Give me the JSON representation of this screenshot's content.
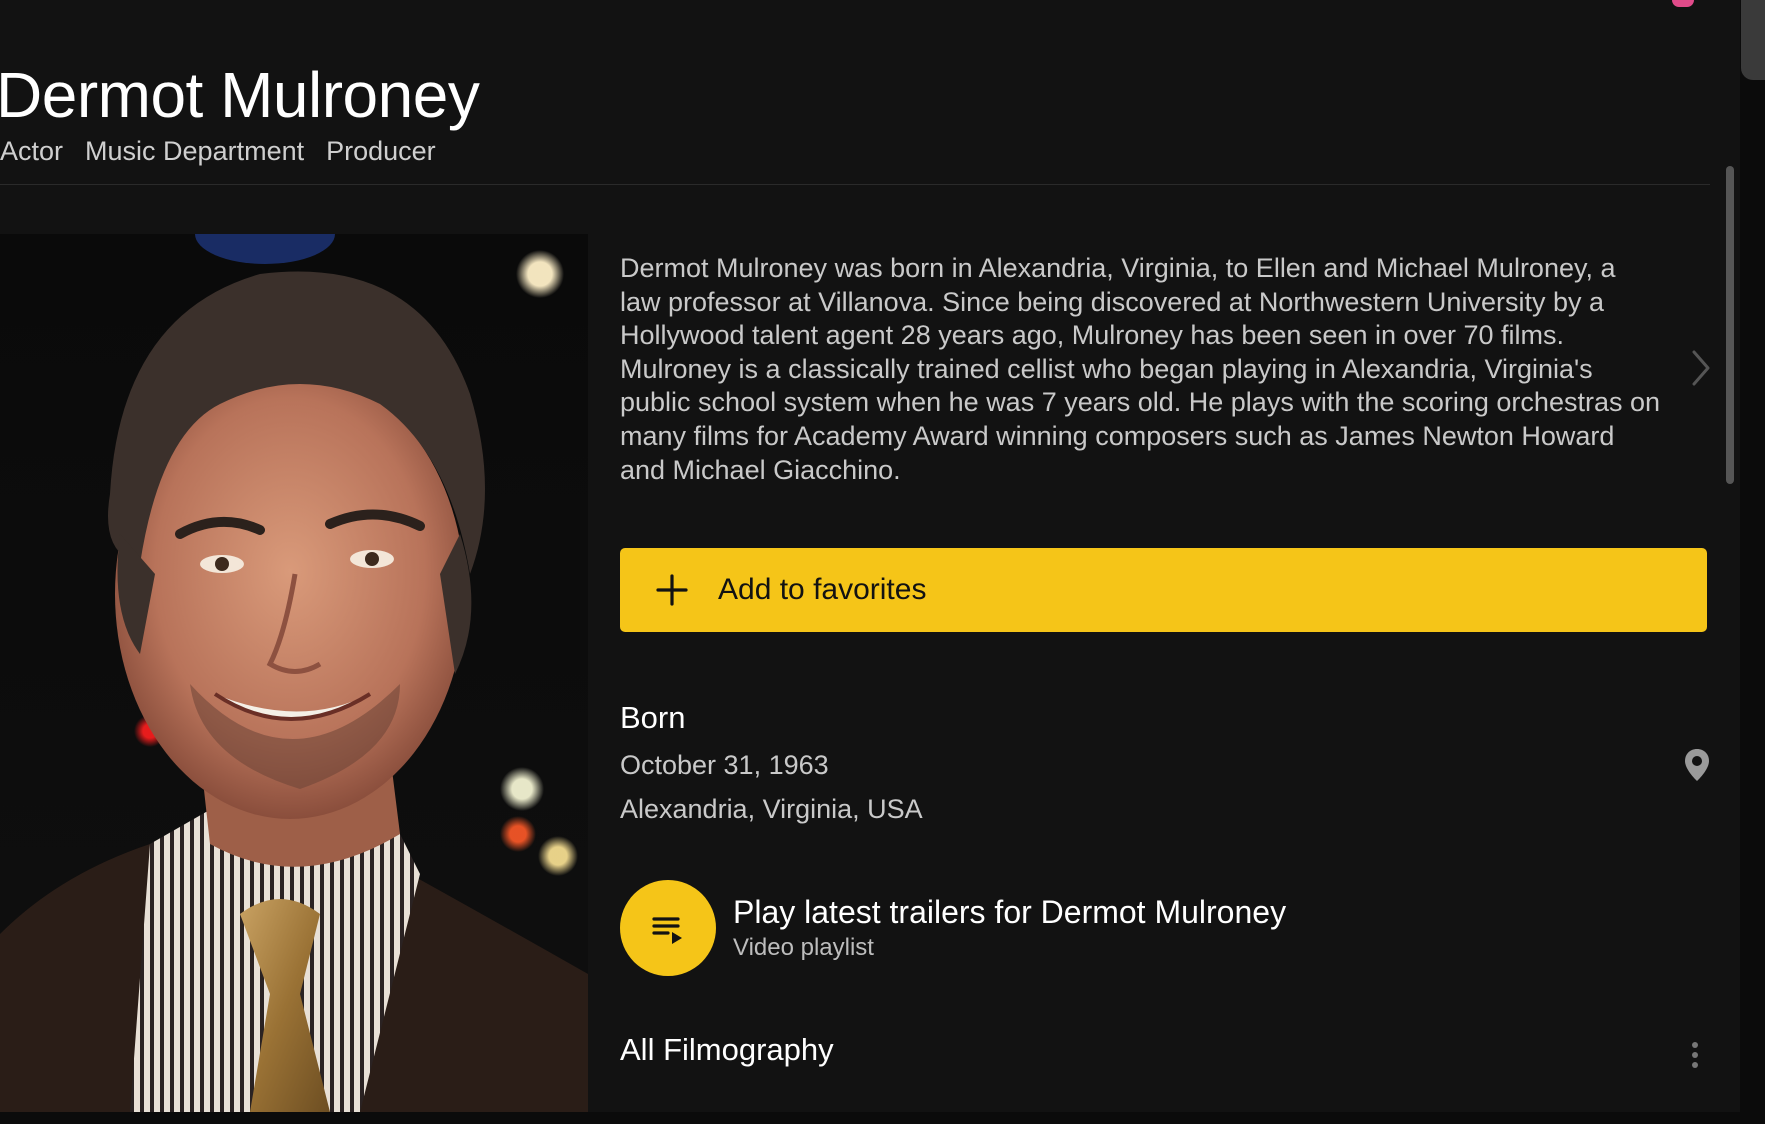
{
  "header": {
    "name": "Dermot Mulroney",
    "roles": [
      "Actor",
      "Music Department",
      "Producer"
    ]
  },
  "bio": {
    "text": "Dermot Mulroney was born in Alexandria, Virginia, to Ellen and Michael Mulroney, a law professor at Villanova. Since being discovered at Northwestern University by a Hollywood talent agent 28 years ago, Mulroney has been seen in over 70 films. Mulroney is a classically trained cellist who began playing in Alexandria, Virginia's public school system when he was 7 years old. He plays with the scoring orchestras on many films for Academy Award winning composers such as James Newton Howard and Michael Giacchino."
  },
  "actions": {
    "favorites_label": "Add to favorites"
  },
  "born": {
    "title": "Born",
    "date": "October 31, 1963",
    "place": "Alexandria, Virginia, USA"
  },
  "trailers": {
    "title": "Play latest trailers for Dermot Mulroney",
    "subtitle": "Video playlist"
  },
  "filmography": {
    "title": "All Filmography"
  },
  "icons": {
    "favorites": "plus-icon",
    "bio_more": "chevron-right-icon",
    "location": "map-pin-icon",
    "playlist": "playlist-play-icon",
    "more": "kebab-menu-icon"
  },
  "colors": {
    "background": "#121212",
    "accent": "#f5c518",
    "text_primary": "#ffffff",
    "text_secondary": "#c9c9c9"
  }
}
